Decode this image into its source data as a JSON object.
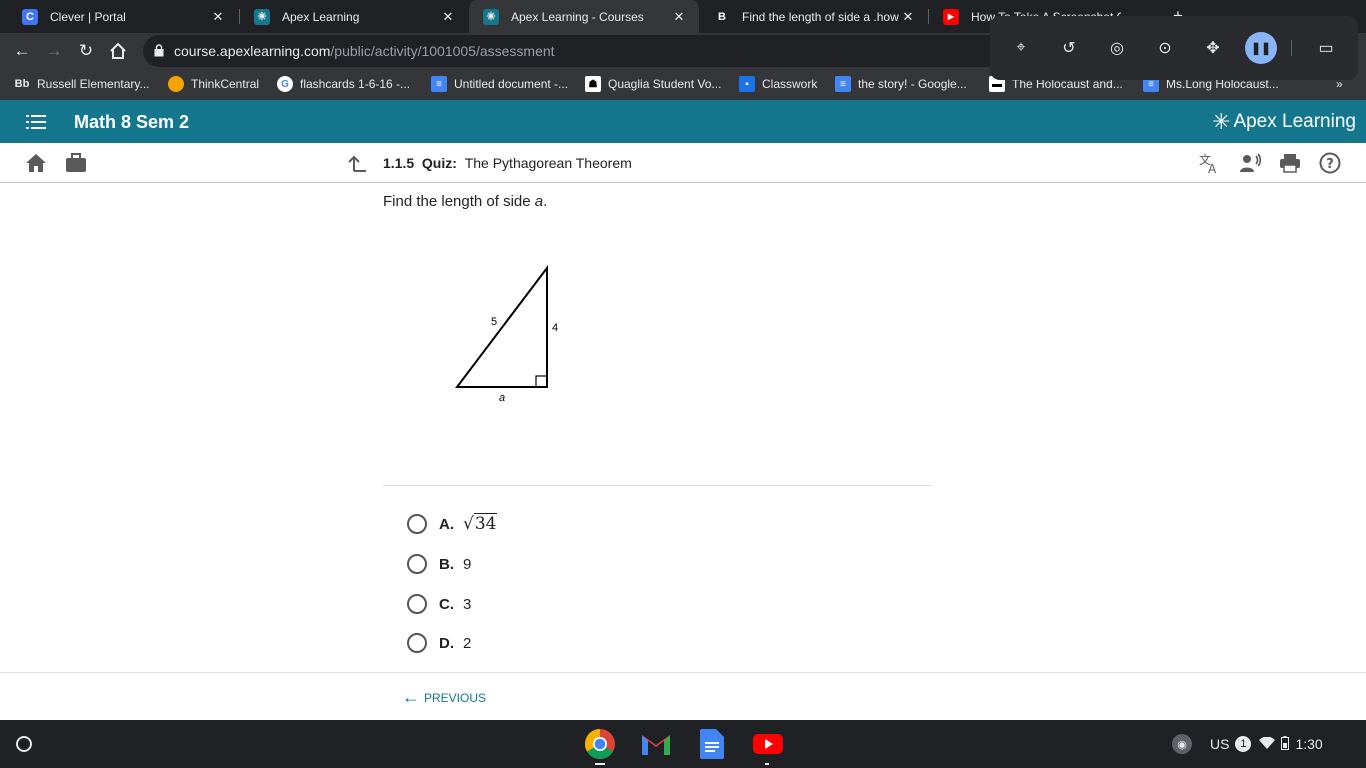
{
  "browser": {
    "tabs": [
      {
        "title": "Clever | Portal",
        "active": false
      },
      {
        "title": "Apex Learning",
        "active": false
      },
      {
        "title": "Apex Learning - Courses",
        "active": true
      },
      {
        "title": "Find the length of side a .how",
        "active": false
      },
      {
        "title": "How To Take A Screenshot On",
        "active": false
      }
    ],
    "url_host": "course.apexlearning.com",
    "url_path": "/public/activity/1001005/assessment",
    "bookmarks": [
      {
        "label": "Russell Elementary..."
      },
      {
        "label": "ThinkCentral"
      },
      {
        "label": "flashcards 1-6-16 -..."
      },
      {
        "label": "Untitled document -..."
      },
      {
        "label": "Quaglia Student Vo..."
      },
      {
        "label": "Classwork"
      },
      {
        "label": "the story! - Google..."
      },
      {
        "label": "The Holocaust and..."
      },
      {
        "label": "Ms.Long Holocaust..."
      }
    ]
  },
  "apex": {
    "course_title": "Math 8 Sem 2",
    "logo_text": "Apex Learning",
    "activity_number": "1.1.5",
    "activity_type": "Quiz:",
    "activity_title": "The Pythagorean Theorem"
  },
  "question": {
    "prompt_prefix": "Find the length of side ",
    "prompt_var": "a",
    "prompt_suffix": ".",
    "triangle": {
      "hypotenuse": "5",
      "leg": "4",
      "unknown": "a"
    },
    "choices": [
      {
        "letter": "A.",
        "text": "34",
        "is_sqrt": true
      },
      {
        "letter": "B.",
        "text": "9"
      },
      {
        "letter": "C.",
        "text": "3"
      },
      {
        "letter": "D.",
        "text": "2"
      }
    ]
  },
  "footer": {
    "previous_label": "PREVIOUS"
  },
  "shelf": {
    "locale": "US",
    "notifications": "1",
    "time": "1:30"
  }
}
